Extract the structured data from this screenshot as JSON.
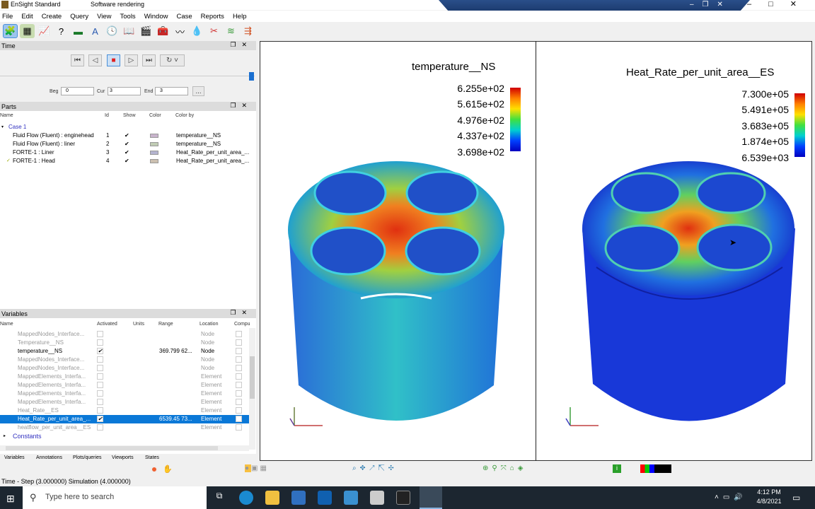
{
  "window": {
    "app_title": "EnSight Standard",
    "render_mode": "Software rendering"
  },
  "menu": [
    "File",
    "Edit",
    "Create",
    "Query",
    "View",
    "Tools",
    "Window",
    "Case",
    "Reports",
    "Help"
  ],
  "time_panel": {
    "title": "Time",
    "beg_label": "Beg",
    "beg": "0",
    "cur_label": "Cur",
    "cur": "3",
    "end_label": "End",
    "end": "3",
    "more": "...",
    "progress": 1.0
  },
  "parts_panel": {
    "title": "Parts",
    "columns": [
      "Name",
      "Id",
      "Show",
      "Color",
      "Color by"
    ],
    "case": "Case 1",
    "rows": [
      {
        "name": "Fluid Flow (Fluent) : enginehead",
        "id": "1",
        "show": "✔",
        "color": "#c8b4cc",
        "color_by": "temperature__NS"
      },
      {
        "name": "Fluid Flow (Fluent) : liner",
        "id": "2",
        "show": "✔",
        "color": "#c0ccb4",
        "color_by": "temperature__NS"
      },
      {
        "name": "FORTE-1 : Liner",
        "id": "3",
        "show": "✔",
        "color": "#b4b4d0",
        "color_by": "Heat_Rate_per_unit_area_..."
      },
      {
        "name": "FORTE-1 : Head",
        "id": "4",
        "show": "✔",
        "color": "#ccc0b0",
        "color_by": "Heat_Rate_per_unit_area_..."
      }
    ]
  },
  "variables_panel": {
    "title": "Variables",
    "columns": [
      "Name",
      "Activated",
      "Units",
      "Range",
      "Location",
      "Compu"
    ],
    "rows": [
      {
        "name": "MappedNodes_Interface...",
        "active": "",
        "range": "",
        "loc": "Node"
      },
      {
        "name": "Temperature__NS",
        "active": "",
        "range": "",
        "loc": "Node"
      },
      {
        "name": "temperature__NS",
        "active": "✔",
        "range": "369.799  62...",
        "loc": "Node"
      },
      {
        "name": "MappedNodes_Interface...",
        "active": "",
        "range": "",
        "loc": "Node"
      },
      {
        "name": "MappedNodes_Interface...",
        "active": "",
        "range": "",
        "loc": "Node"
      },
      {
        "name": "MappedElements_Interfa...",
        "active": "",
        "range": "",
        "loc": "Element"
      },
      {
        "name": "MappedElements_Interfa...",
        "active": "",
        "range": "",
        "loc": "Element"
      },
      {
        "name": "MappedElements_Interfa...",
        "active": "",
        "range": "",
        "loc": "Element"
      },
      {
        "name": "MappedElements_Interfa...",
        "active": "",
        "range": "",
        "loc": "Element"
      },
      {
        "name": "Heat_Rate__ES",
        "active": "",
        "range": "",
        "loc": "Element"
      },
      {
        "name": "Heat_Rate_per_unit_area_...",
        "active": "✔",
        "range": "6539.45  73...",
        "loc": "Element"
      },
      {
        "name": "heatflow_per_unit_area__ES",
        "active": "",
        "range": "",
        "loc": "Element"
      }
    ],
    "constants": "Constants"
  },
  "tabs": [
    "Variables",
    "Annotations",
    "Plots/queries",
    "Viewports",
    "States"
  ],
  "status": "Time - Step (3.000000) Simulation (4.000000)",
  "viewports": [
    {
      "title": "temperature__NS",
      "values": [
        "6.255e+02",
        "5.615e+02",
        "4.976e+02",
        "4.337e+02",
        "3.698e+02"
      ]
    },
    {
      "title": "Heat_Rate_per_unit_area__ES",
      "values": [
        "7.300e+05",
        "5.491e+05",
        "3.683e+05",
        "1.874e+05",
        "6.539e+03"
      ]
    }
  ],
  "taskbar": {
    "search_placeholder": "Type here to search",
    "time": "4:12 PM",
    "date": "4/8/2021"
  }
}
